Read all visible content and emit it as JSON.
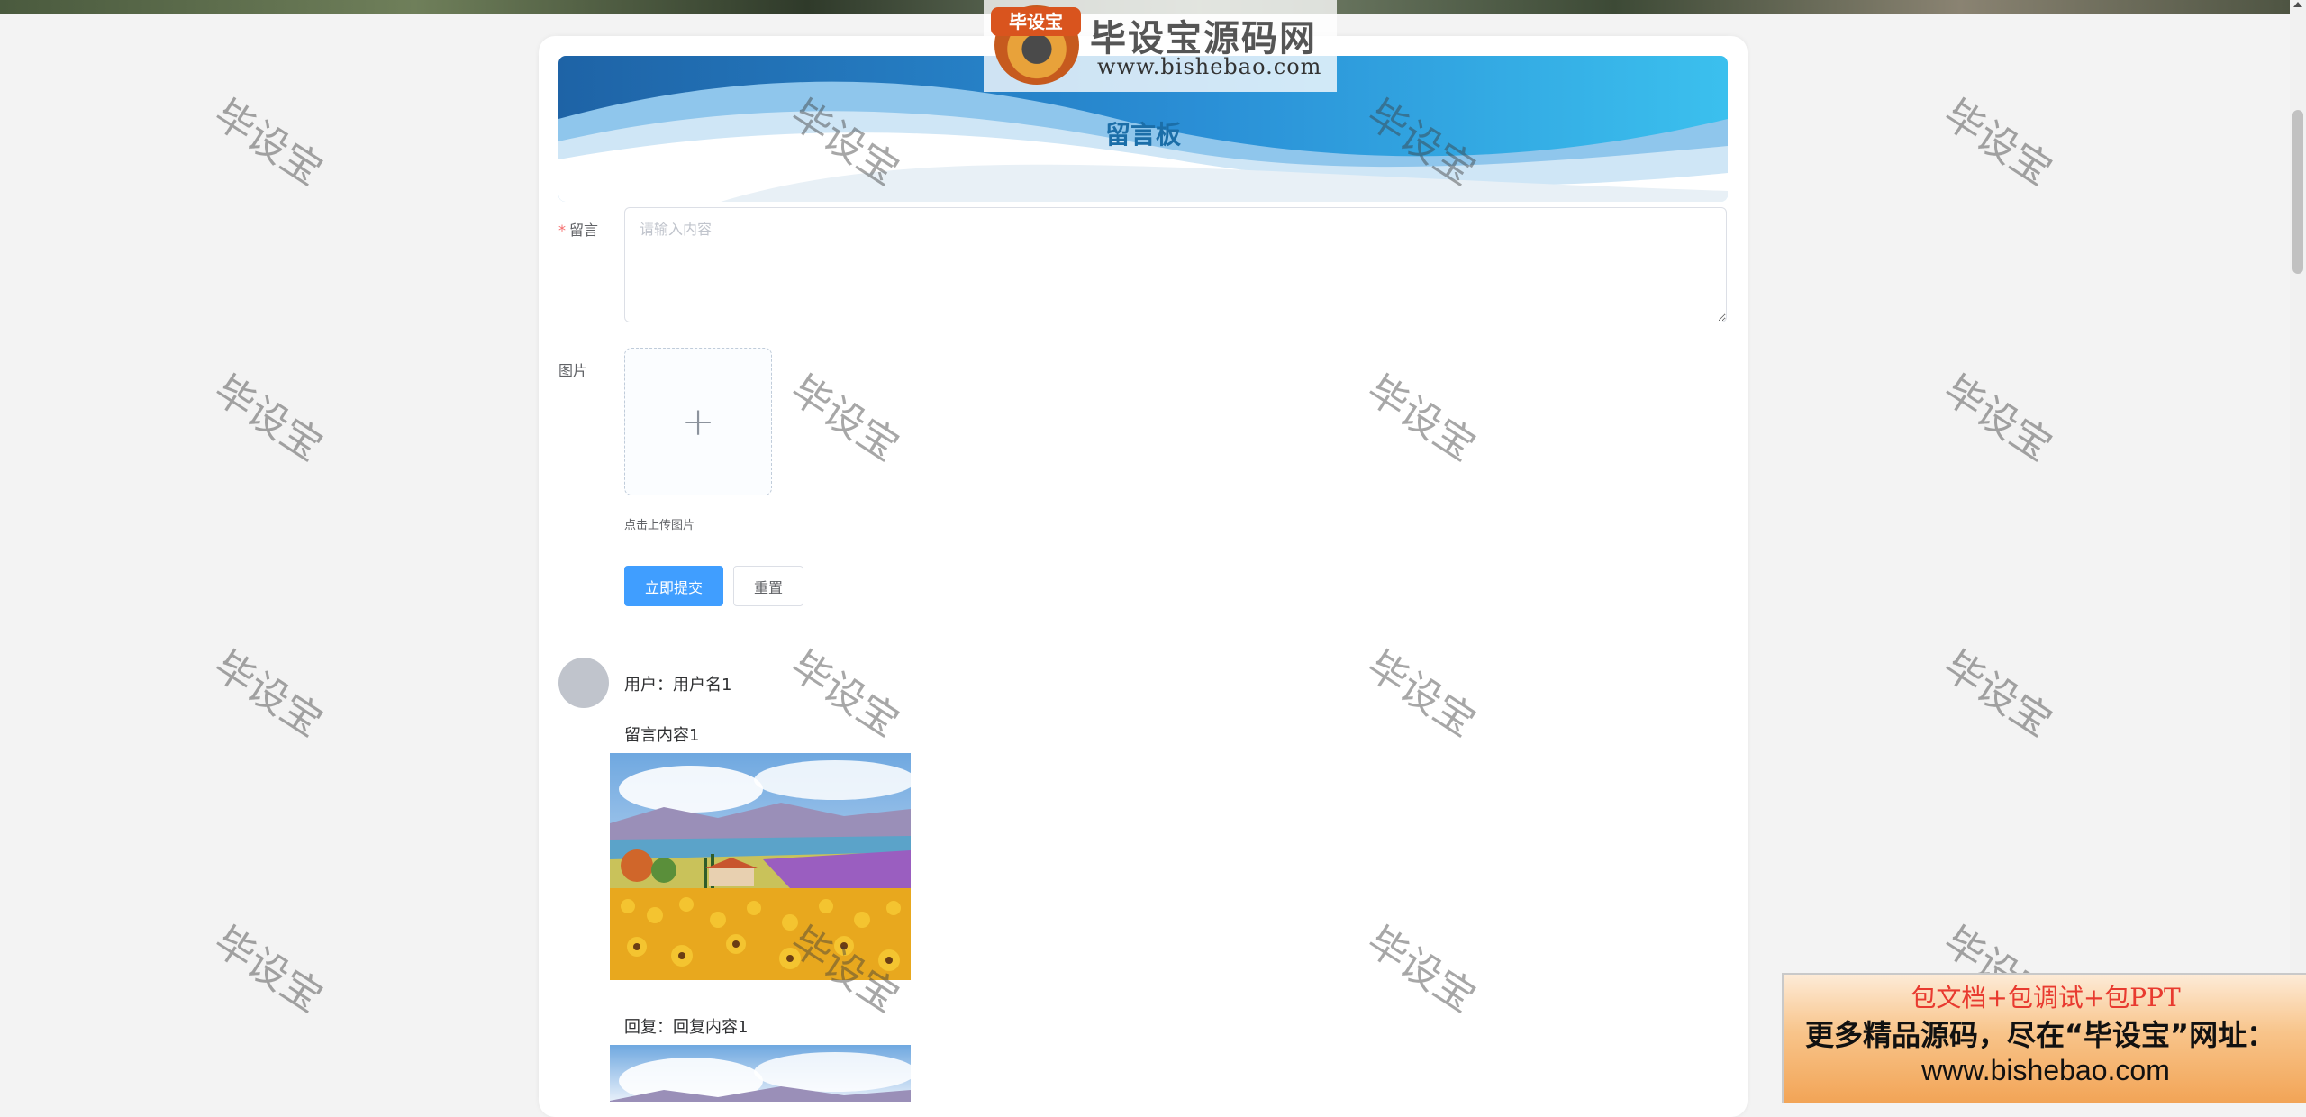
{
  "watermark": {
    "text": "毕设宝"
  },
  "logo": {
    "badge": "毕设宝",
    "name": "毕设宝源码网",
    "url": "www.bishebao.com"
  },
  "board": {
    "title": "留言板"
  },
  "form": {
    "message_label": "留言",
    "message_placeholder": "请输入内容",
    "image_label": "图片",
    "upload_plus": "+",
    "upload_tip": "点击上传图片",
    "submit_label": "立即提交",
    "reset_label": "重置"
  },
  "messages": [
    {
      "user": "用户：用户名1",
      "content": "留言内容1",
      "reply": "回复：回复内容1"
    }
  ],
  "ad": {
    "line1": "包文档+包调试+包PPT",
    "line2": "更多精品源码，尽在“毕设宝”网址：",
    "line3": "www.bishebao.com"
  },
  "colors": {
    "primary": "#409eff",
    "banner_title": "#1b6ea8",
    "required_star": "#f56c6c"
  }
}
